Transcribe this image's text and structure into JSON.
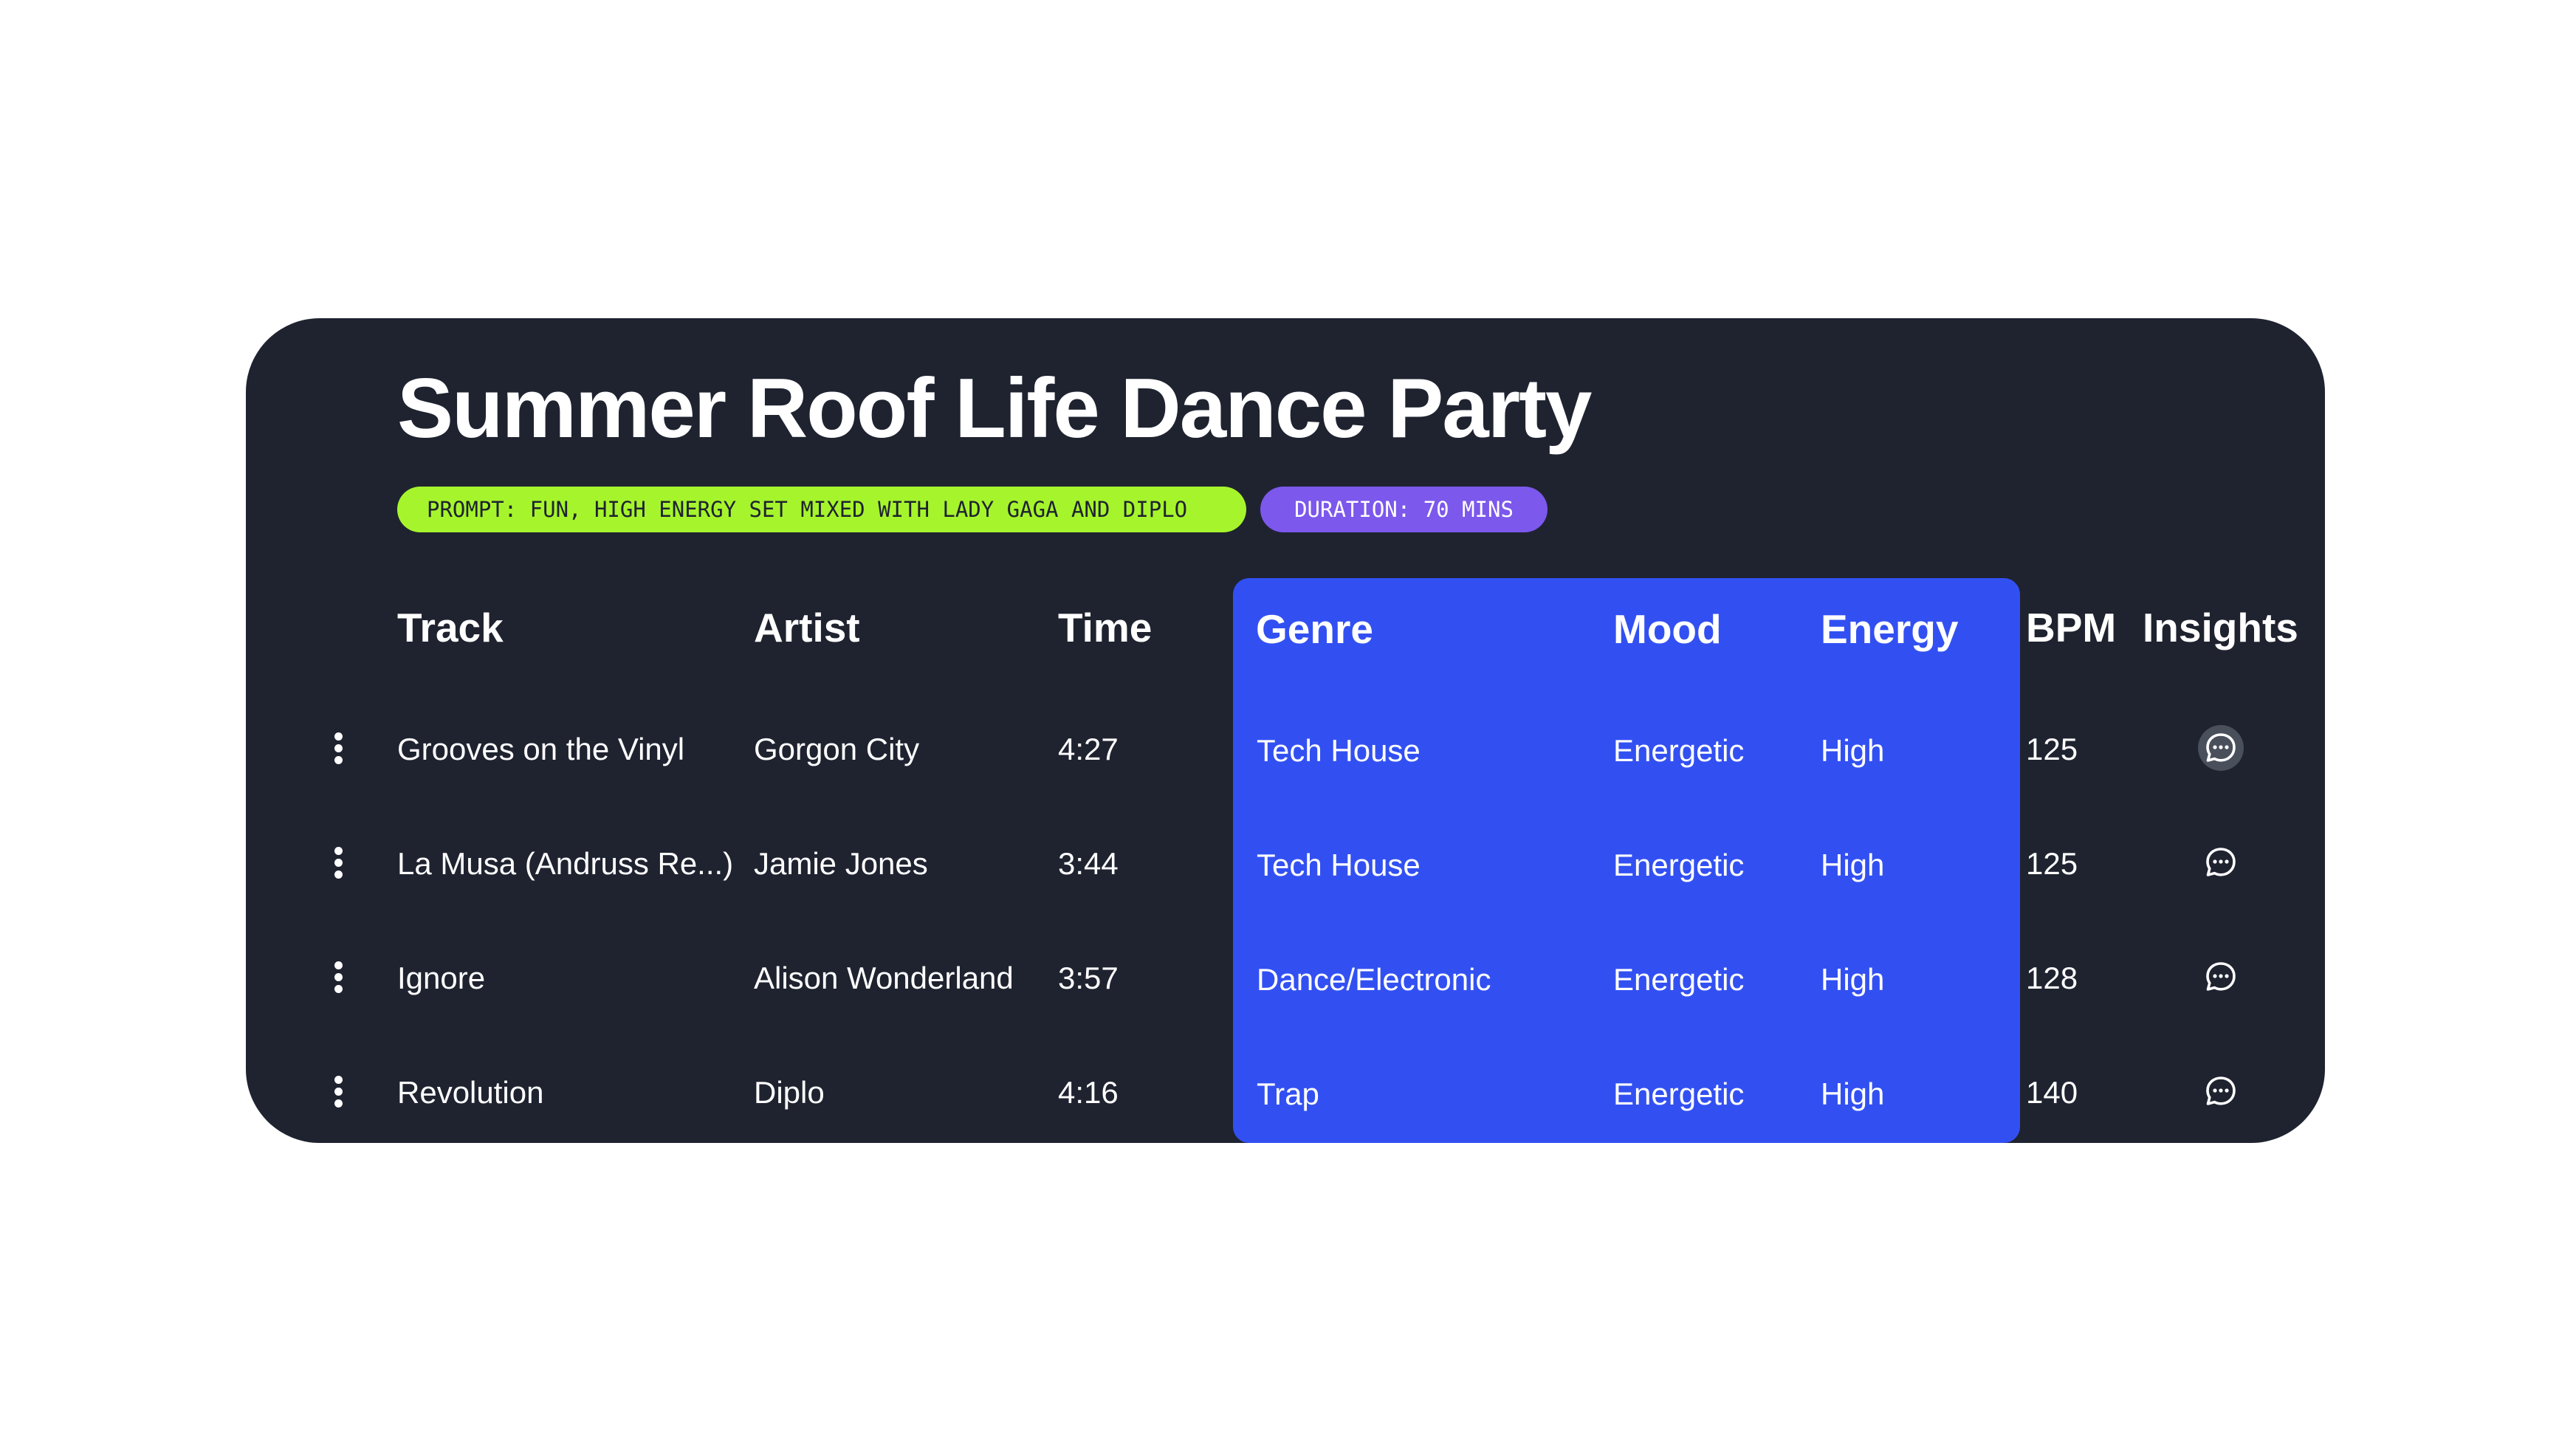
{
  "playlist": {
    "title": "Summer Roof Life Dance Party",
    "prompt_label": "PROMPT: FUN, HIGH ENERGY SET MIXED WITH LADY GAGA AND DIPLO",
    "duration_label": "DURATION: 70 MINS"
  },
  "colors": {
    "background": "#1f2330",
    "prompt_pill": "#a6f52c",
    "duration_pill": "#7c58ec",
    "highlight": "#3250f2"
  },
  "table": {
    "headers": {
      "track": "Track",
      "artist": "Artist",
      "time": "Time",
      "genre": "Genre",
      "mood": "Mood",
      "energy": "Energy",
      "bpm": "BPM",
      "insights": "Insights"
    },
    "rows": [
      {
        "track": "Grooves on the Vinyl",
        "artist": "Gorgon City",
        "time": "4:27",
        "genre": "Tech House",
        "mood": "Energetic",
        "energy": "High",
        "bpm": "125",
        "menu_icon": "more-vertical-icon",
        "insight_icon": "chat-bubble-icon"
      },
      {
        "track": "La Musa (Andruss Re...)",
        "artist": "Jamie Jones",
        "time": "3:44",
        "genre": "Tech House",
        "mood": "Energetic",
        "energy": "High",
        "bpm": "125",
        "menu_icon": "more-vertical-icon",
        "insight_icon": "chat-bubble-icon"
      },
      {
        "track": "Ignore",
        "artist": "Alison Wonderland",
        "time": "3:57",
        "genre": "Dance/Electronic",
        "mood": "Energetic",
        "energy": "High",
        "bpm": "128",
        "menu_icon": "more-vertical-icon",
        "insight_icon": "chat-bubble-icon"
      },
      {
        "track": "Revolution",
        "artist": "Diplo",
        "time": "4:16",
        "genre": "Trap",
        "mood": "Energetic",
        "energy": "High",
        "bpm": "140",
        "menu_icon": "more-vertical-icon",
        "insight_icon": "chat-bubble-icon"
      }
    ]
  }
}
